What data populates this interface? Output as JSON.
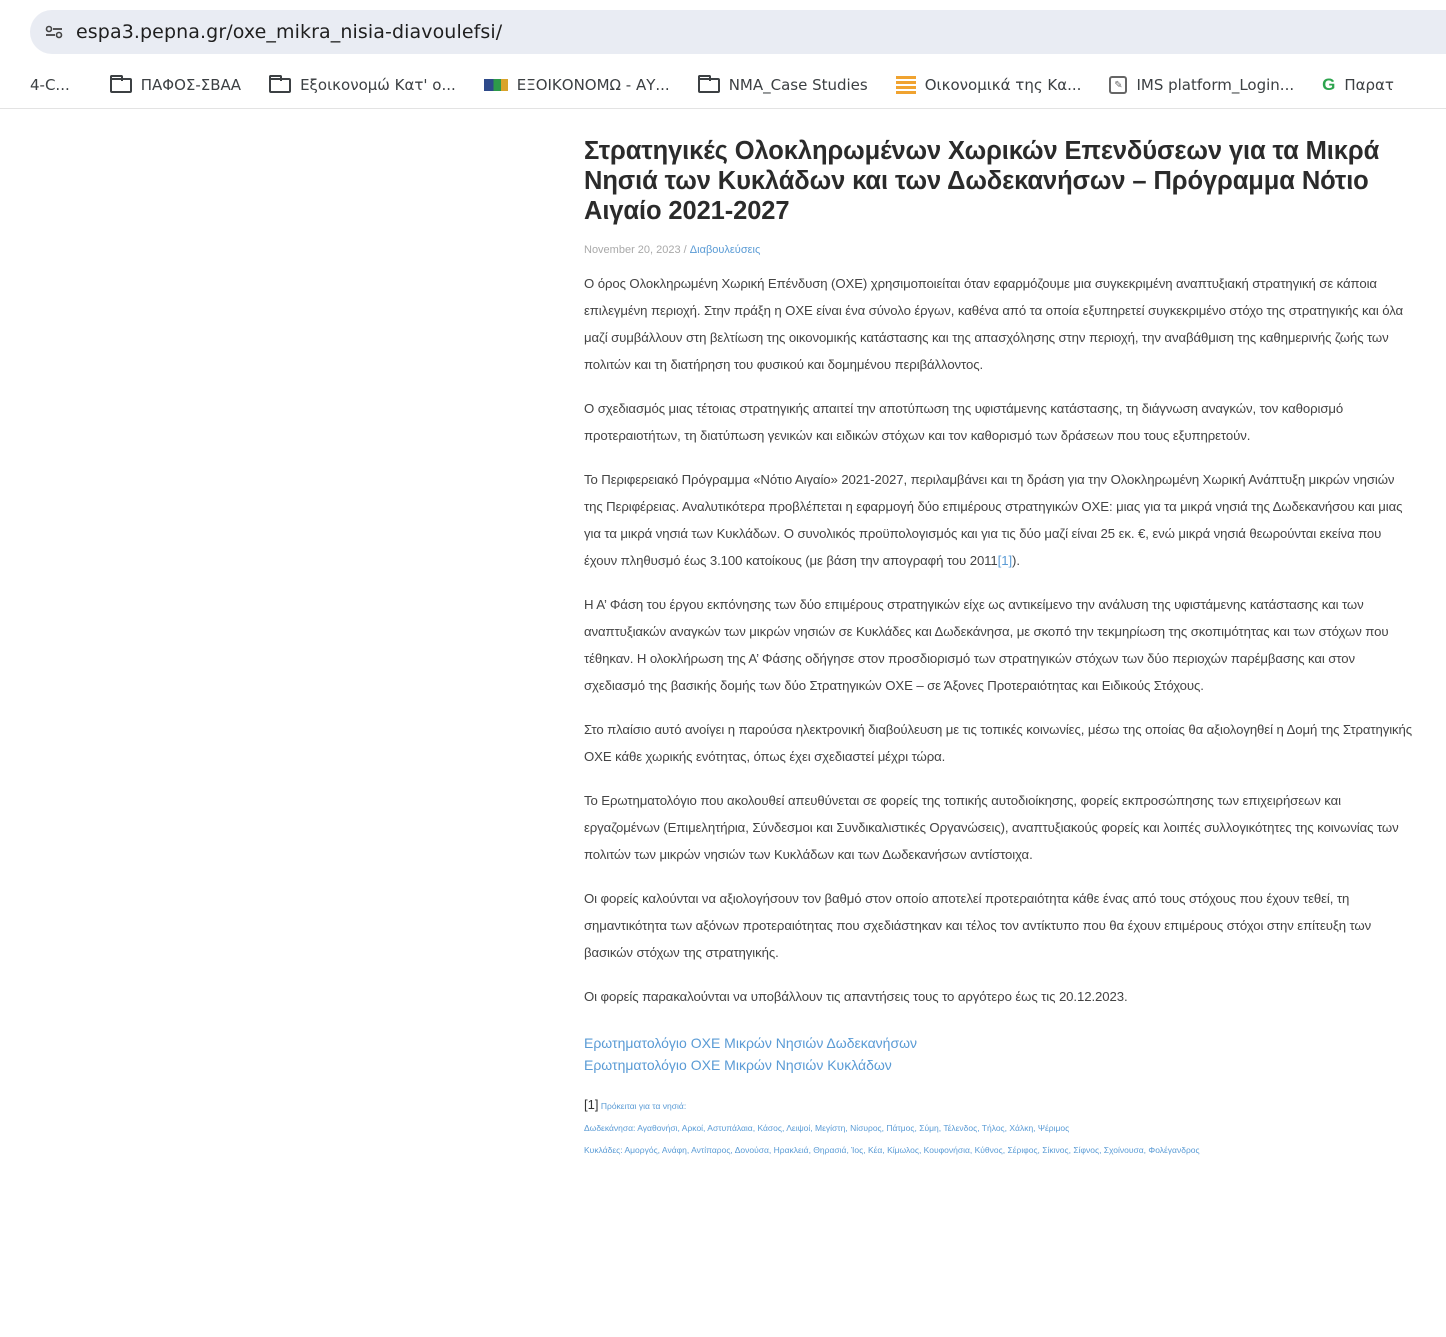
{
  "browser": {
    "url": "espa3.pepna.gr/oxe_mikra_nisia-diavoulefsi/"
  },
  "bookmarks": [
    {
      "label": "4-C...",
      "icon": "none"
    },
    {
      "label": "ΠΑΦΟΣ-ΣΒΑΑ",
      "icon": "folder-icon"
    },
    {
      "label": "Εξοικονομώ Κατ' ο...",
      "icon": "folder-icon"
    },
    {
      "label": "ΕΞΟΙΚΟΝΟΜΩ - ΑΥ...",
      "icon": "flag-icon"
    },
    {
      "label": "NMA_Case Studies",
      "icon": "folder-icon"
    },
    {
      "label": "Οικονομικά της Κα...",
      "icon": "coins-icon"
    },
    {
      "label": "IMS platform_Login...",
      "icon": "page-icon"
    },
    {
      "label": "Παρατ",
      "icon": "g-icon"
    }
  ],
  "article": {
    "title": "Στρατηγικές Ολοκληρωμένων Χωρικών Επενδύσεων για τα Μικρά Νησιά των Κυκλάδων και των Δωδεκανήσων – Πρόγραμμα Νότιο Αιγαίο 2021-2027",
    "date": "November 20, 2023",
    "separator": " / ",
    "category": "Διαβουλεύσεις",
    "paragraphs": [
      "Ο όρος Ολοκληρωμένη Χωρική Επένδυση (ΟΧΕ) χρησιμοποιείται όταν εφαρμόζουμε μια συγκεκριμένη αναπτυξιακή στρατηγική σε κάποια επιλεγμένη περιοχή. Στην πράξη η ΟΧΕ είναι ένα σύνολο έργων, καθένα από τα οποία εξυπηρετεί συγκεκριμένο στόχο της στρατηγικής και όλα μαζί συμβάλλουν στη βελτίωση της οικονομικής κατάστασης και της απασχόλησης στην περιοχή, την αναβάθμιση της καθημερινής ζωής των πολιτών και τη διατήρηση του φυσικού και δομημένου περιβάλλοντος.",
      "Ο σχεδιασμός μιας τέτοιας στρατηγικής απαιτεί την αποτύπωση της υφιστάμενης κατάστασης, τη διάγνωση αναγκών, τον καθορισμό προτεραιοτήτων, τη διατύπωση γενικών και ειδικών στόχων και τον καθορισμό των δράσεων που τους εξυπηρετούν."
    ],
    "p3_text": "Το Περιφερειακό Πρόγραμμα «Νότιο Αιγαίο» 2021-2027, περιλαμβάνει και τη δράση για την Ολοκληρωμένη Χωρική Ανάπτυξη μικρών νησιών της Περιφέρειας. Αναλυτικότερα προβλέπεται η εφαρμογή δύο επιμέρους στρατηγικών ΟΧΕ: μιας για τα μικρά νησιά της Δωδεκανήσου και μιας για τα μικρά νησιά των Κυκλάδων. Ο συνολικός προϋπολογισμός και για τις δύο μαζί είναι 25 εκ. €, ενώ μικρά νησιά θεωρούνται εκείνα που έχουν πληθυσμό έως 3.100 κατοίκους (με βάση την απογραφή του 2011",
    "p3_ref": "[1]",
    "p3_end": ").",
    "paragraphs_after": [
      "Η Α’ Φάση του έργου εκπόνησης των δύο επιμέρους στρατηγικών είχε ως αντικείμενο την ανάλυση της υφιστάμενης κατάστασης και των αναπτυξιακών αναγκών των μικρών νησιών σε Κυκλάδες και Δωδεκάνησα, με σκοπό την τεκμηρίωση της σκοπιμότητας και των στόχων που τέθηκαν. Η ολοκλήρωση της Α’ Φάσης οδήγησε στον προσδιορισμό των στρατηγικών στόχων των δύο περιοχών παρέμβασης και στον σχεδιασμό της βασικής δομής των δύο Στρατηγικών ΟΧΕ – σε Άξονες Προτεραιότητας και Ειδικούς Στόχους.",
      "Στο πλαίσιο αυτό ανοίγει η παρούσα ηλεκτρονική διαβούλευση με τις τοπικές κοινωνίες, μέσω της οποίας θα αξιολογηθεί η Δομή της Στρατηγικής ΟΧΕ κάθε χωρικής ενότητας, όπως έχει σχεδιαστεί μέχρι τώρα.",
      "Το Ερωτηματολόγιο που ακολουθεί απευθύνεται σε φορείς της τοπικής αυτοδιοίκησης, φορείς εκπροσώπησης των επιχειρήσεων και εργαζομένων (Επιμελητήρια, Σύνδεσμοι και Συνδικαλιστικές Οργανώσεις), αναπτυξιακούς φορείς και λοιπές συλλογικότητες της κοινωνίας των πολιτών των μικρών νησιών των Κυκλάδων και των Δωδεκανήσων αντίστοιχα.",
      "Οι φορείς καλούνται να αξιολογήσουν τον βαθμό στον οποίο αποτελεί προτεραιότητα κάθε ένας από τους στόχους που έχουν τεθεί, τη σημαντικότητα των αξόνων προτεραιότητας που σχεδιάστηκαν και τέλος τον αντίκτυπο που θα έχουν επιμέρους στόχοι στην επίτευξη των βασικών στόχων της στρατηγικής.",
      "Οι φορείς παρακαλούνται να υποβάλλουν τις απαντήσεις τους το αργότερο έως τις 20.12.2023."
    ],
    "links": [
      "Ερωτηματολόγιο ΟΧΕ Μικρών Νησιών Δωδεκανήσων",
      "Ερωτηματολόγιο ΟΧΕ Μικρών Νησιών Κυκλάδων"
    ],
    "footnote": {
      "num": "[1]",
      "intro": "Πρόκειται για τα νησιά:",
      "dodecanese": "Δωδεκάνησα: Αγαθονήσι, Αρκοί, Αστυπάλαια, Κάσος, Λειψοί, Μεγίστη, Νίσυρος, Πάτμος, Σύμη, Τέλενδος, Τήλος, Χάλκη, Ψέριμος",
      "cyclades": "Κυκλάδες: Αμοργός, Ανάφη, Αντίπαρος, Δονούσα, Ηρακλειά, Θηρασιά, Ίος, Κέα, Κίμωλος, Κουφονήσια, Κύθνος, Σέριφος, Σίκινος, Σίφνος, Σχοίνουσα, Φολέγανδρος"
    }
  }
}
